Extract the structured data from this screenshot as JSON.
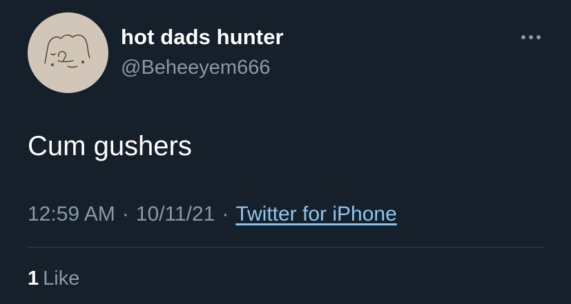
{
  "user": {
    "display_name": "hot dads hunter",
    "handle": "@Beheeyem666",
    "avatar_colors": {
      "background": "#d1c6b8",
      "stroke": "#3a3630"
    }
  },
  "header": {
    "more_icon": "more-horizontal-icon"
  },
  "tweet": {
    "text": "Cum gushers"
  },
  "meta": {
    "time": "12:59 AM",
    "separator_1": "·",
    "date": "10/11/21",
    "separator_2": "·",
    "source": "Twitter for iPhone"
  },
  "stats": {
    "likes_count": "1",
    "likes_label": "Like"
  },
  "colors": {
    "background": "#15202b",
    "primary_text": "#ffffff",
    "secondary_text": "#8b98a5",
    "link": "#8ec5ef",
    "divider": "#38444d"
  }
}
